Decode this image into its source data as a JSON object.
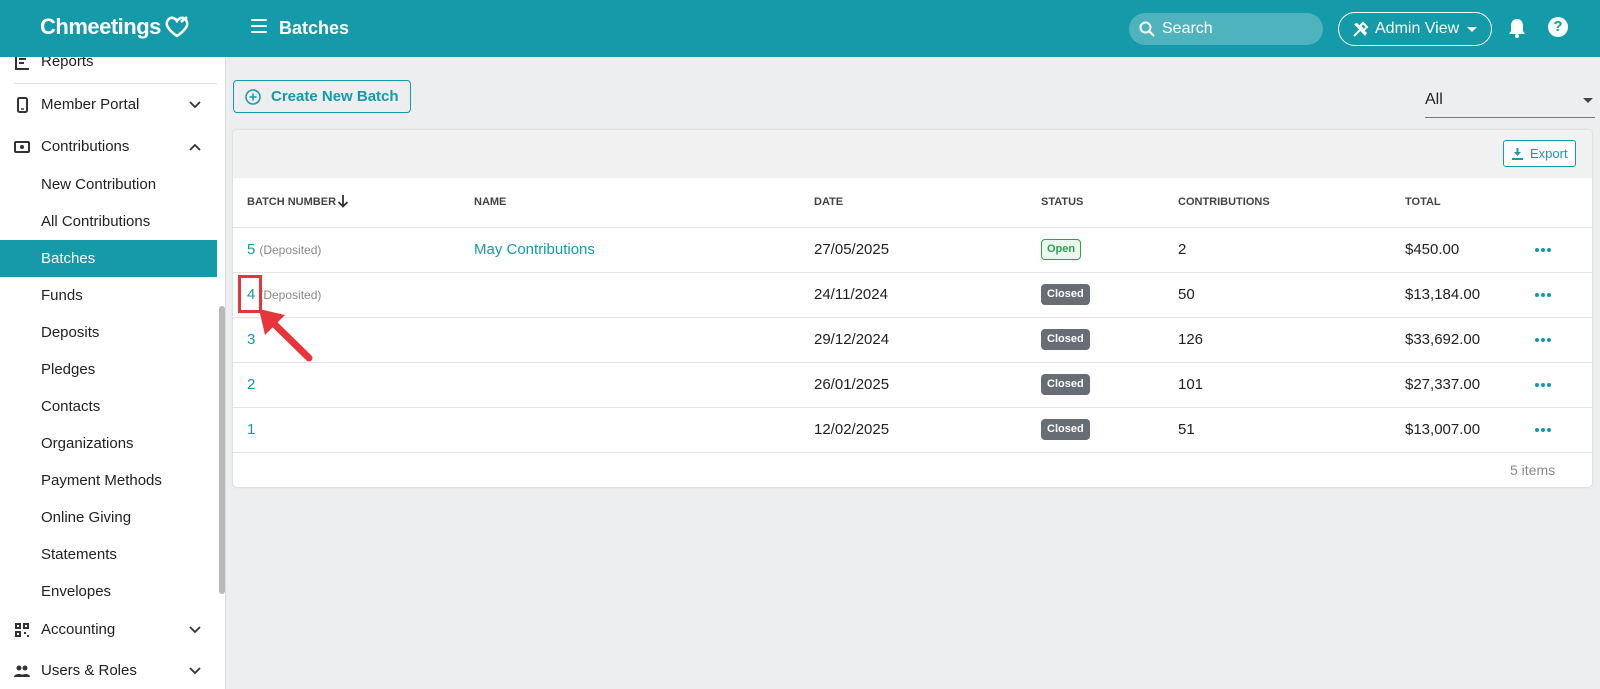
{
  "app": {
    "logo_text": "Chmeetings",
    "page_title": "Batches"
  },
  "header": {
    "search_placeholder": "Search",
    "admin_view_label": "Admin View"
  },
  "sidebar": {
    "items": [
      {
        "label": "Reports",
        "icon": "reports-icon"
      },
      {
        "label": "Member Portal",
        "icon": "phone-icon",
        "chevron": "down"
      },
      {
        "label": "Contributions",
        "icon": "money-icon",
        "chevron": "up"
      },
      {
        "label": "New Contribution"
      },
      {
        "label": "All Contributions"
      },
      {
        "label": "Batches",
        "active": true
      },
      {
        "label": "Funds"
      },
      {
        "label": "Deposits"
      },
      {
        "label": "Pledges"
      },
      {
        "label": "Contacts"
      },
      {
        "label": "Organizations"
      },
      {
        "label": "Payment Methods"
      },
      {
        "label": "Online Giving"
      },
      {
        "label": "Statements"
      },
      {
        "label": "Envelopes"
      },
      {
        "label": "Accounting",
        "icon": "qr-icon",
        "chevron": "down"
      },
      {
        "label": "Users & Roles",
        "icon": "users-icon",
        "chevron": "down"
      }
    ]
  },
  "main": {
    "create_button_label": "Create New Batch",
    "filter_value": "All",
    "export_label": "Export",
    "columns": [
      "BATCH NUMBER",
      "NAME",
      "DATE",
      "STATUS",
      "CONTRIBUTIONS",
      "TOTAL"
    ],
    "rows": [
      {
        "batch": "5",
        "deposited": "(Deposited)",
        "name": "May Contributions",
        "date": "27/05/2025",
        "status": "Open",
        "contributions": "2",
        "total": "$450.00"
      },
      {
        "batch": "4",
        "deposited": "(Deposited)",
        "name": "",
        "date": "24/11/2024",
        "status": "Closed",
        "contributions": "50",
        "total": "$13,184.00"
      },
      {
        "batch": "3",
        "deposited": "",
        "name": "",
        "date": "29/12/2024",
        "status": "Closed",
        "contributions": "126",
        "total": "$33,692.00"
      },
      {
        "batch": "2",
        "deposited": "",
        "name": "",
        "date": "26/01/2025",
        "status": "Closed",
        "contributions": "101",
        "total": "$27,337.00"
      },
      {
        "batch": "1",
        "deposited": "",
        "name": "",
        "date": "12/02/2025",
        "status": "Closed",
        "contributions": "51",
        "total": "$13,007.00"
      }
    ],
    "items_count": "5 items"
  },
  "colors": {
    "brand": "#149aa8",
    "open_badge": "#2e9e55",
    "closed_badge": "#666d75",
    "annotation": "#e8353b"
  }
}
